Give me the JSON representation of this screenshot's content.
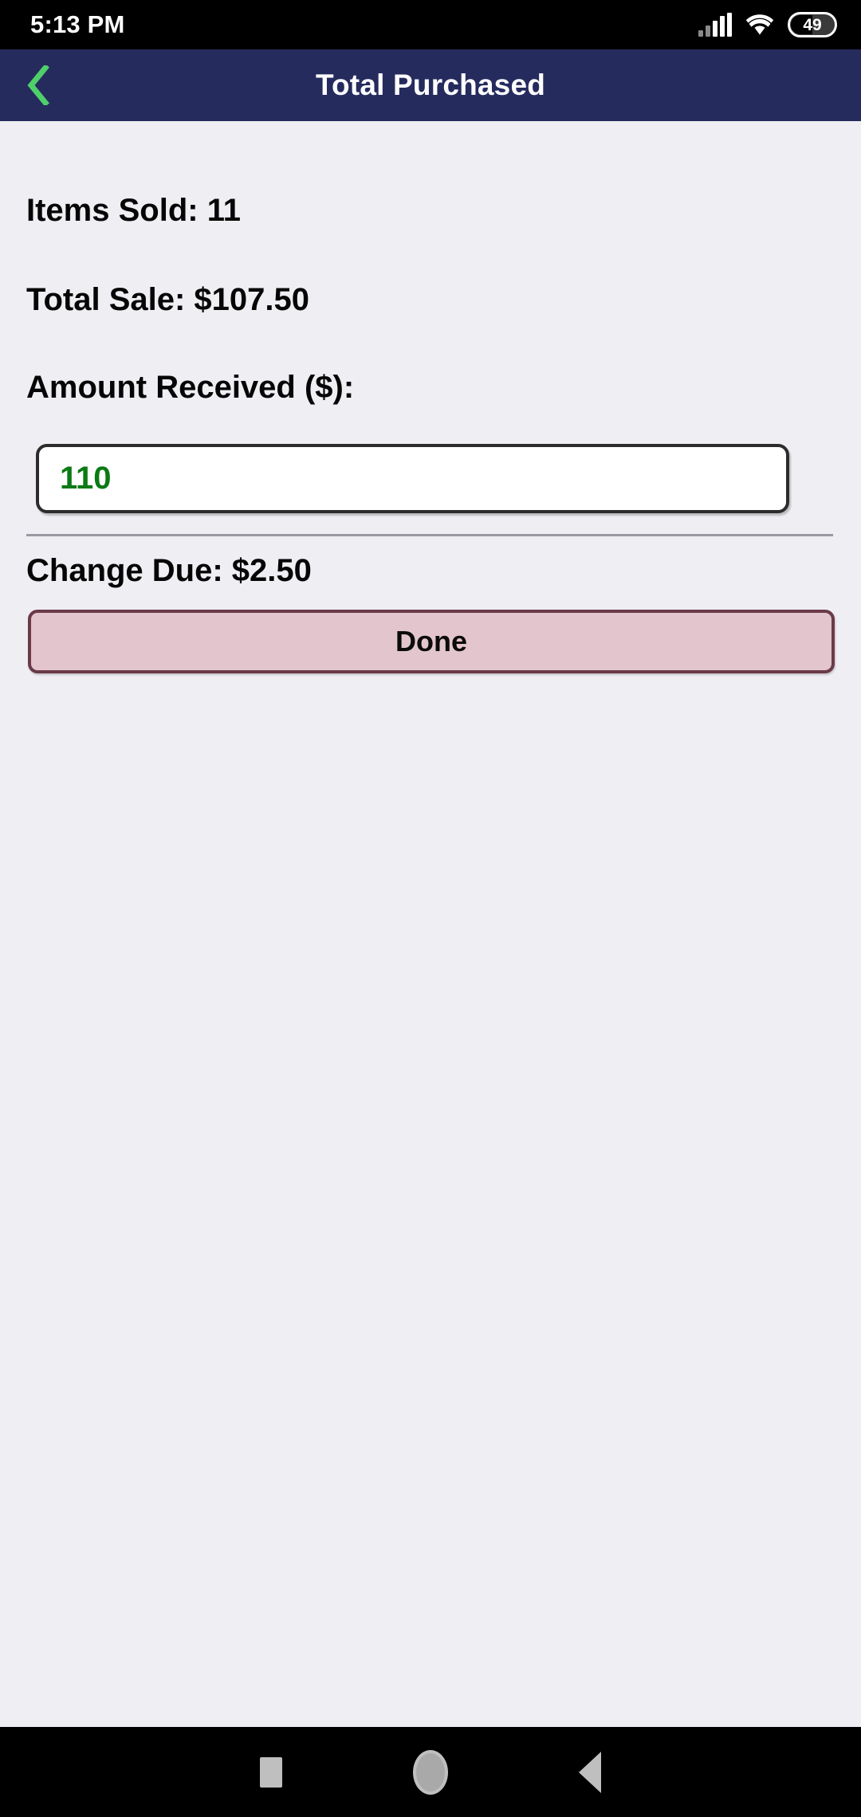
{
  "status_bar": {
    "time": "5:13 PM",
    "signal_icon": "signal-bars-icon",
    "wifi_icon": "wifi-icon",
    "battery_icon": "battery-icon",
    "battery_level": "49"
  },
  "app_bar": {
    "back_icon": "chevron-left-icon",
    "title": "Total Purchased",
    "background_color": "#262B5E",
    "back_icon_color": "#4FCF6A"
  },
  "main": {
    "items_sold_line": "Items Sold: 11",
    "total_sale_line": "Total Sale: $107.50",
    "amount_received_label": "Amount Received ($):",
    "amount_received_value": "110",
    "amount_received_placeholder": "",
    "amount_received_text_color": "#0B7A14",
    "change_due_line": "Change Due: $2.50",
    "done_label": "Done",
    "done_fill_color": "#E2C5CD",
    "done_border_color": "#6B3A48",
    "background_color": "#EFEEF3"
  },
  "nav_bar": {
    "recents_icon": "square-icon",
    "home_icon": "circle-icon",
    "back_icon": "triangle-left-icon"
  }
}
